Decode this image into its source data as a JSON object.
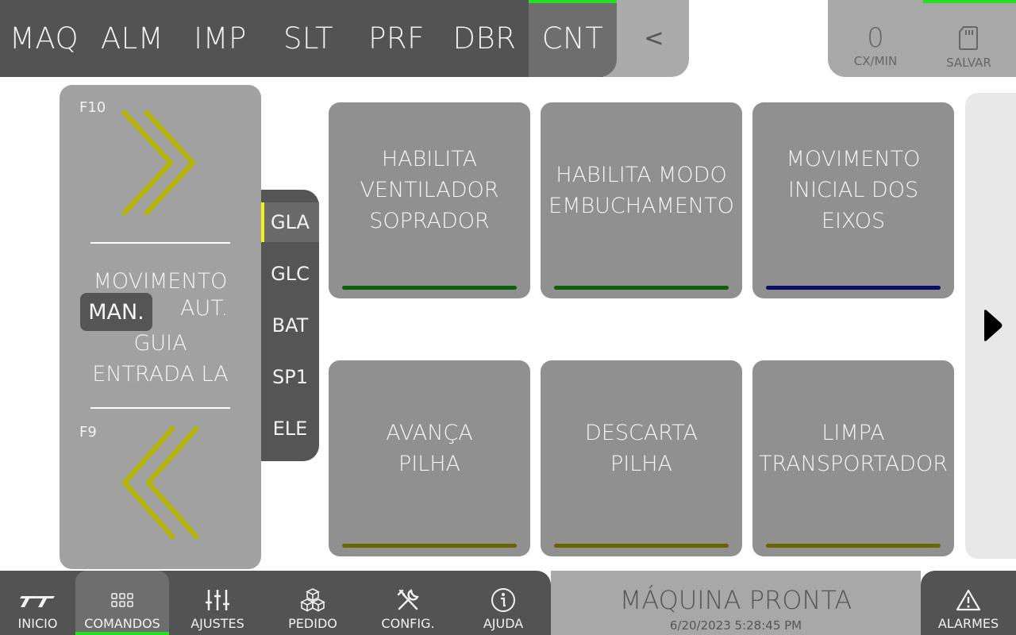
{
  "top_nav": {
    "tabs": [
      {
        "label": "MAQ"
      },
      {
        "label": "ALM"
      },
      {
        "label": "IMP"
      },
      {
        "label": "SLT"
      },
      {
        "label": "PRF"
      },
      {
        "label": "DBR"
      },
      {
        "label": "CNT",
        "active": true
      }
    ],
    "back_label": "<"
  },
  "top_right": {
    "rate_value": "0",
    "rate_label": "CX/MIN",
    "save_label": "SALVAR",
    "save_icon": "sd-card-icon"
  },
  "manual_panel": {
    "forward_key": "F10",
    "reverse_key": "F9",
    "title": "MOVIMENTO",
    "mode_manual": "MAN.",
    "mode_auto": "AUT.",
    "subtitle_line1": "GUIA",
    "subtitle_line2": "ENTRADA LA",
    "arrow_color": "#b5b500",
    "selected_mode": "MAN."
  },
  "groups": {
    "items": [
      "GLA",
      "GLC",
      "BAT",
      "SP1",
      "ELE"
    ],
    "active": "GLA",
    "active_color": "#f0f01a"
  },
  "commands": [
    {
      "label": "HABILITA\nVENTILADOR\nSOPRADOR",
      "bar_color": "#0b620b"
    },
    {
      "label": "HABILITA MODO\nEMBUCHAMENTO",
      "bar_color": "#0b620b"
    },
    {
      "label": "MOVIMENTO\nINICIAL DOS EIXOS",
      "bar_color": "#0d0d6a"
    },
    {
      "label": "AVANÇA\nPILHA",
      "bar_color": "#6a6500"
    },
    {
      "label": "DESCARTA\nPILHA",
      "bar_color": "#6a6500"
    },
    {
      "label": "LIMPA\nTRANSPORTADOR",
      "bar_color": "#6a6500"
    }
  ],
  "bottom_nav": {
    "items": [
      {
        "label": "INICIO",
        "icon": "logo-icon"
      },
      {
        "label": "COMANDOS",
        "icon": "grid-icon",
        "active": true
      },
      {
        "label": "AJUSTES",
        "icon": "sliders-icon"
      },
      {
        "label": "PEDIDO",
        "icon": "boxes-icon"
      },
      {
        "label": "CONFIG.",
        "icon": "tools-icon"
      },
      {
        "label": "AJUDA",
        "icon": "info-icon"
      }
    ]
  },
  "status": {
    "title": "MÁQUINA PRONTA",
    "timestamp": "6/20/2023 5:28:45 PM"
  },
  "alarms": {
    "label": "ALARMES",
    "icon": "warning-icon"
  },
  "colors": {
    "active_indicator": "#22e022",
    "bar_dark": "#535353",
    "button_gray": "#919091"
  }
}
